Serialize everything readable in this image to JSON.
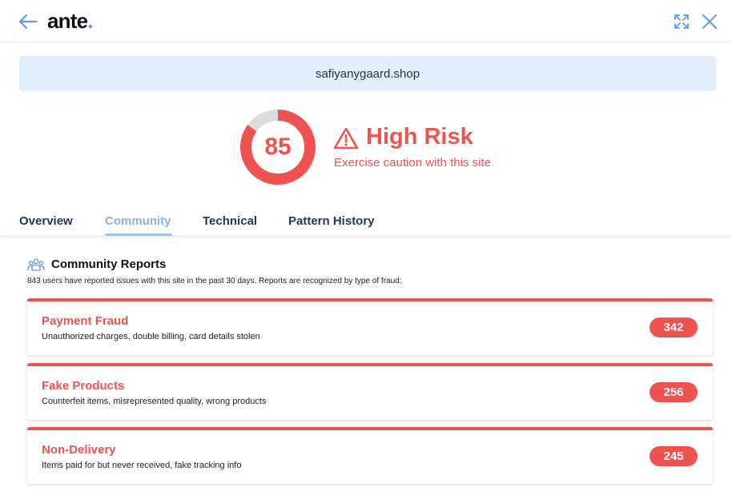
{
  "header": {
    "logo_text": "ante",
    "logo_dot": ".",
    "back_icon": "arrow-left-icon",
    "expand_icon": "expand-icon",
    "close_icon": "close-icon"
  },
  "site": {
    "url": "safiyanygaard.shop"
  },
  "risk": {
    "score": "85",
    "score_fraction": 0.85,
    "level": "High Risk",
    "message": "Exercise caution with this site",
    "icon": "warning-triangle-icon",
    "color": "#ef5350",
    "track_color": "#dcdcdc"
  },
  "tabs": [
    {
      "label": "Overview",
      "active": false
    },
    {
      "label": "Community",
      "active": true
    },
    {
      "label": "Technical",
      "active": false
    },
    {
      "label": "Pattern History",
      "active": false
    }
  ],
  "community": {
    "icon": "users-icon",
    "title": "Community Reports",
    "description": "843 users have reported issues with this site in the past 30 days. Reports are recognized by type of fraud:",
    "reports": [
      {
        "title": "Payment Fraud",
        "description": "Unauthorized charges, double billing, card details stolen",
        "count": "342"
      },
      {
        "title": "Fake Products",
        "description": "Counterfeit items, misrepresented quality, wrong products",
        "count": "256"
      },
      {
        "title": "Non-Delivery",
        "description": "Items paid for but never received, fake tracking info",
        "count": "245"
      }
    ]
  },
  "colors": {
    "accent_red": "#ef5350",
    "brand_blue": "#5d9be0",
    "url_bar_bg": "#e2effc",
    "tab_text": "#1f3658",
    "tab_active": "#86b3e3"
  }
}
